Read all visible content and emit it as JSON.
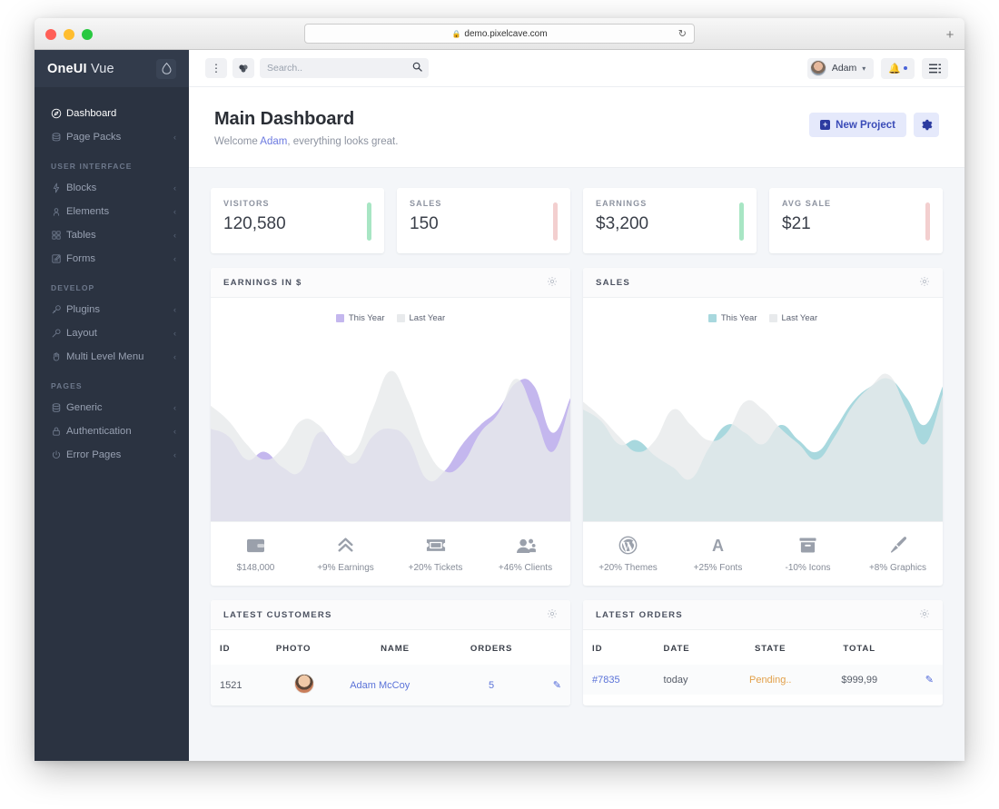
{
  "browser": {
    "url": "demo.pixelcave.com",
    "lock_icon": "lock-icon",
    "reload_icon": "reload-icon",
    "new_tab_label": "+"
  },
  "sidebar": {
    "brand_first": "OneUI",
    "brand_second": "Vue",
    "badge_icon": "droplet-icon",
    "groups": [
      {
        "section": "",
        "items": [
          {
            "label": "Dashboard",
            "icon": "compass-icon",
            "caret": "",
            "active": true
          },
          {
            "label": "Page Packs",
            "icon": "layers-icon",
            "caret": "‹",
            "active": false
          }
        ]
      },
      {
        "section": "USER INTERFACE",
        "items": [
          {
            "label": "Blocks",
            "icon": "bolt-icon",
            "caret": "‹",
            "active": false
          },
          {
            "label": "Elements",
            "icon": "atom-icon",
            "caret": "‹",
            "active": false
          },
          {
            "label": "Tables",
            "icon": "grid-icon",
            "caret": "‹",
            "active": false
          },
          {
            "label": "Forms",
            "icon": "form-icon",
            "caret": "‹",
            "active": false
          }
        ]
      },
      {
        "section": "DEVELOP",
        "items": [
          {
            "label": "Plugins",
            "icon": "plug-icon",
            "caret": "‹",
            "active": false
          },
          {
            "label": "Layout",
            "icon": "wrench-icon",
            "caret": "‹",
            "active": false
          },
          {
            "label": "Multi Level Menu",
            "icon": "hand-icon",
            "caret": "‹",
            "active": false
          }
        ]
      },
      {
        "section": "PAGES",
        "items": [
          {
            "label": "Generic",
            "icon": "database-icon",
            "caret": "‹",
            "active": false
          },
          {
            "label": "Authentication",
            "icon": "lock-icon",
            "caret": "‹",
            "active": false
          },
          {
            "label": "Error Pages",
            "icon": "power-icon",
            "caret": "‹",
            "active": false
          }
        ]
      }
    ]
  },
  "topbar": {
    "kebab_icon": "vertical-dots-icon",
    "apps_icon": "apps-icon",
    "search_placeholder": "Search..",
    "search_value": "",
    "search_icon": "magnifier-icon",
    "user_name": "Adam",
    "user_caret": "▾",
    "bell_icon": "bell-icon",
    "menu_icon": "list-menu-icon"
  },
  "page_header": {
    "title": "Main Dashboard",
    "welcome_prefix": "Welcome ",
    "welcome_user": "Adam",
    "welcome_suffix": ", everything looks great.",
    "new_project_label": "New Project",
    "new_project_icon": "plus-square-icon",
    "settings_icon": "gear-icon"
  },
  "stats": [
    {
      "label": "VISITORS",
      "value": "120,580",
      "bar_color": "#a8e6c4"
    },
    {
      "label": "SALES",
      "value": "150",
      "bar_color": "#f3cfcf"
    },
    {
      "label": "EARNINGS",
      "value": "$3,200",
      "bar_color": "#a8e6c4"
    },
    {
      "label": "AVG SALE",
      "value": "$21",
      "bar_color": "#f3cfcf"
    }
  ],
  "charts": [
    {
      "title": "EARNINGS IN $",
      "gear_icon": "gear-icon",
      "legend": [
        {
          "label": "This Year",
          "color": "#c4b7ee"
        },
        {
          "label": "Last Year",
          "color": "#e8eaec"
        }
      ],
      "footer": [
        {
          "icon": "wallet-icon",
          "label": "$148,000"
        },
        {
          "icon": "chevrons-up-icon",
          "label": "+9% Earnings"
        },
        {
          "icon": "ticket-icon",
          "label": "+20% Tickets"
        },
        {
          "icon": "users-icon",
          "label": "+46% Clients"
        }
      ]
    },
    {
      "title": "SALES",
      "gear_icon": "gear-icon",
      "legend": [
        {
          "label": "This Year",
          "color": "#a8d8de"
        },
        {
          "label": "Last Year",
          "color": "#e8eaec"
        }
      ],
      "footer": [
        {
          "icon": "wordpress-icon",
          "label": "+20% Themes"
        },
        {
          "icon": "font-icon",
          "label": "+25% Fonts"
        },
        {
          "icon": "archive-icon",
          "label": "-10% Icons"
        },
        {
          "icon": "brush-icon",
          "label": "+8% Graphics"
        }
      ]
    }
  ],
  "chart_data": [
    {
      "type": "area",
      "title": "EARNINGS IN $",
      "xlabel": "",
      "ylabel": "",
      "grid": false,
      "legend_position": "top-center",
      "ylim": [
        0,
        100
      ],
      "x": [
        0,
        1,
        2,
        3,
        4,
        5,
        6,
        7,
        8,
        9,
        10,
        11,
        12,
        13,
        14,
        15,
        16,
        17,
        18,
        19,
        20
      ],
      "series": [
        {
          "name": "This Year",
          "color": "#c4b7ee",
          "values": [
            48,
            44,
            32,
            36,
            28,
            26,
            46,
            38,
            30,
            44,
            48,
            42,
            22,
            26,
            40,
            50,
            58,
            72,
            70,
            46,
            64
          ]
        },
        {
          "name": "Last Year",
          "color": "#e8eaec",
          "values": [
            60,
            52,
            40,
            32,
            38,
            52,
            50,
            38,
            36,
            58,
            78,
            62,
            38,
            26,
            30,
            46,
            56,
            74,
            56,
            36,
            62
          ]
        }
      ]
    },
    {
      "type": "area",
      "title": "SALES",
      "xlabel": "",
      "ylabel": "",
      "grid": false,
      "legend_position": "top-center",
      "ylim": [
        0,
        100
      ],
      "x": [
        0,
        1,
        2,
        3,
        4,
        5,
        6,
        7,
        8,
        9,
        10,
        11,
        12,
        13,
        14,
        15,
        16,
        17,
        18,
        19,
        20
      ],
      "series": [
        {
          "name": "This Year",
          "color": "#a8d8de",
          "values": [
            58,
            52,
            40,
            42,
            34,
            28,
            22,
            38,
            50,
            46,
            40,
            50,
            42,
            36,
            48,
            62,
            70,
            74,
            64,
            50,
            70
          ]
        },
        {
          "name": "Last Year",
          "color": "#e8eaec",
          "values": [
            62,
            54,
            44,
            36,
            42,
            58,
            50,
            42,
            46,
            62,
            58,
            48,
            40,
            32,
            44,
            60,
            70,
            76,
            58,
            40,
            66
          ]
        }
      ]
    }
  ],
  "tables": [
    {
      "title": "LATEST CUSTOMERS",
      "gear_icon": "gear-icon",
      "columns": [
        "ID",
        "PHOTO",
        "NAME",
        "ORDERS",
        ""
      ],
      "rows": [
        {
          "id": "1521",
          "photo": "customer-avatar",
          "name": "Adam McCoy",
          "orders": "5",
          "action_icon": "pencil-icon"
        }
      ]
    },
    {
      "title": "LATEST ORDERS",
      "gear_icon": "gear-icon",
      "columns": [
        "ID",
        "DATE",
        "STATE",
        "TOTAL",
        ""
      ],
      "rows": [
        {
          "id": "#7835",
          "date": "today",
          "state": "Pending..",
          "total": "$999,99",
          "action_icon": "pencil-icon"
        }
      ]
    }
  ],
  "colors": {
    "sidebar_bg": "#2b3341",
    "sidebar_header_bg": "#323b4b",
    "accent_blue": "#4a63d8",
    "accent_light": "#e5e9fb",
    "page_bg": "#f4f6f9",
    "earnings_series": "#c4b7ee",
    "sales_series": "#a8d8de",
    "last_year_series": "#e8eaec",
    "positive": "#a8e6c4",
    "negative": "#f3cfcf",
    "pending": "#e2a04a"
  }
}
